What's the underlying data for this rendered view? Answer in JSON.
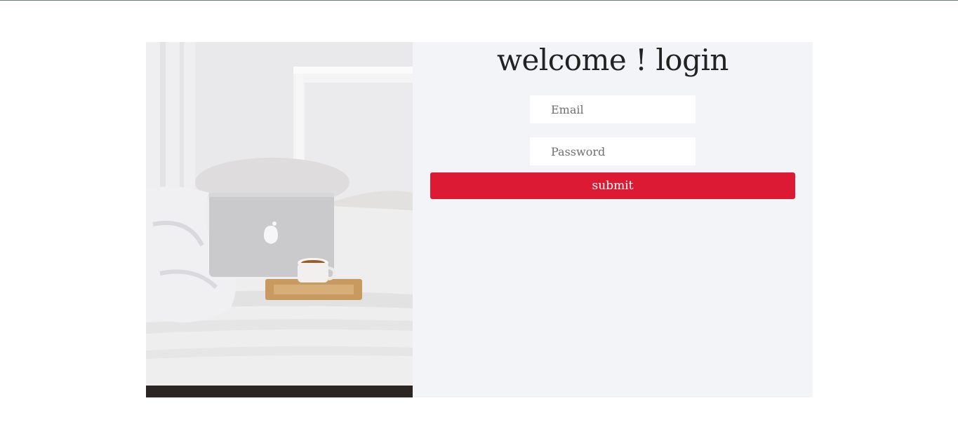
{
  "login": {
    "title": "welcome ! login",
    "email_placeholder": "Email",
    "password_placeholder": "Password",
    "submit_label": "submit"
  },
  "colors": {
    "panel_background": "#f3f4f8",
    "submit_button": "#dc1a33",
    "top_rule": "#6b7f78"
  }
}
